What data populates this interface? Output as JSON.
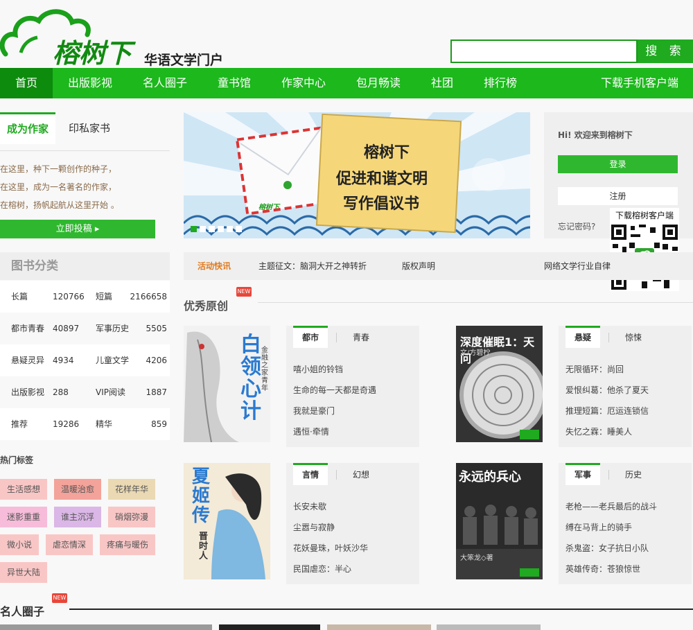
{
  "header": {
    "brand": "榕树下",
    "tagline": "华语文学门户",
    "search_placeholder": "",
    "search_button": "搜 索"
  },
  "nav": {
    "items": [
      "首页",
      "出版影视",
      "名人圈子",
      "童书馆",
      "作家中心",
      "包月畅读",
      "社团",
      "排行榜"
    ],
    "download": "下载手机客户端"
  },
  "writer": {
    "tabs": [
      "成为作家",
      "印私家书"
    ],
    "lines": [
      "在这里，种下一颗创作的种子，",
      "在这里，成为一名著名的作家，",
      "在榕树，扬帆起航从这里开始 。"
    ],
    "submit": "立即投稿"
  },
  "banner": {
    "line1": "榕树下",
    "line2": "促进和谐文明",
    "line3": "写作倡议书",
    "mini_logo": "榕树下",
    "dots": 6
  },
  "login": {
    "welcome": "Hi! 欢迎来到榕树下",
    "login": "登录",
    "register": "注册",
    "forgot": "忘记密码?",
    "qr_caption": "下载榕树客户端"
  },
  "categories": {
    "title": "图书分类",
    "rows": [
      {
        "a": "长篇",
        "an": "120766",
        "b": "短篇",
        "bn": "2166658"
      },
      {
        "a": "都市青春",
        "an": "40897",
        "b": "军事历史",
        "bn": "5505"
      },
      {
        "a": "悬疑灵异",
        "an": "4934",
        "b": "儿童文学",
        "bn": "4206"
      },
      {
        "a": "出版影视",
        "an": "288",
        "b": "VIP阅读",
        "bn": "1887"
      },
      {
        "a": "推荐",
        "an": "19286",
        "b": "精华",
        "bn": "859"
      }
    ]
  },
  "hot_tags": {
    "title": "热门标签",
    "tags": [
      "生活感想",
      "温暖治愈",
      "花样年华",
      "迷影重重",
      "谁主沉浮",
      "硝烟弥漫",
      "微小说",
      "虐恋情深",
      "疼痛与暖伤",
      "异世大陆"
    ]
  },
  "news": {
    "label": "活动快讯",
    "items": [
      "主题征文：脑洞大开之神转折",
      "版权声明",
      "网络文学行业自律"
    ]
  },
  "original": {
    "title": "优秀原创",
    "new_badge": "NEW",
    "panels": [
      {
        "tabs": [
          "都市",
          "青春"
        ],
        "items": [
          "嘻小姐的铃铛",
          "生命的每一天都是奇遇",
          "我就是豪门",
          "遇恒·牵情"
        ],
        "cover_title": "白领心计",
        "cover_sub": "金融之家青年"
      },
      {
        "tabs": [
          "悬疑",
          "惊悚"
        ],
        "items": [
          "无限循环：尚回",
          "爱恨纠葛：他杀了夏天",
          "推理短篇：厄运连锁信",
          "失忆之霖：睡美人"
        ],
        "cover_title": "深度催眠1：天问",
        "cover_sub": "文/方碧柠"
      },
      {
        "tabs": [
          "言情",
          "幻想"
        ],
        "items": [
          "长安未歇",
          "尘嚣与寂静",
          "花妖曼珠，叶妖沙华",
          "民国虐恋：半心"
        ],
        "cover_title": "夏姬传",
        "cover_sub": "晋时人"
      },
      {
        "tabs": [
          "军事",
          "历史"
        ],
        "items": [
          "老枪——老兵最后的战斗",
          "缚在马背上的骑手",
          "杀鬼盗：女子抗日小队",
          "英雄传奇：苍狼惊世"
        ],
        "cover_title": "永远的兵心",
        "cover_sub": "大笨龙◇著"
      }
    ]
  },
  "celebrity": {
    "title": "名人圈子",
    "new_badge": "NEW"
  },
  "colors": {
    "brand_green": "#1cb81c",
    "dark_green": "#0c8b0c",
    "accent_orange": "#e07a1f"
  }
}
